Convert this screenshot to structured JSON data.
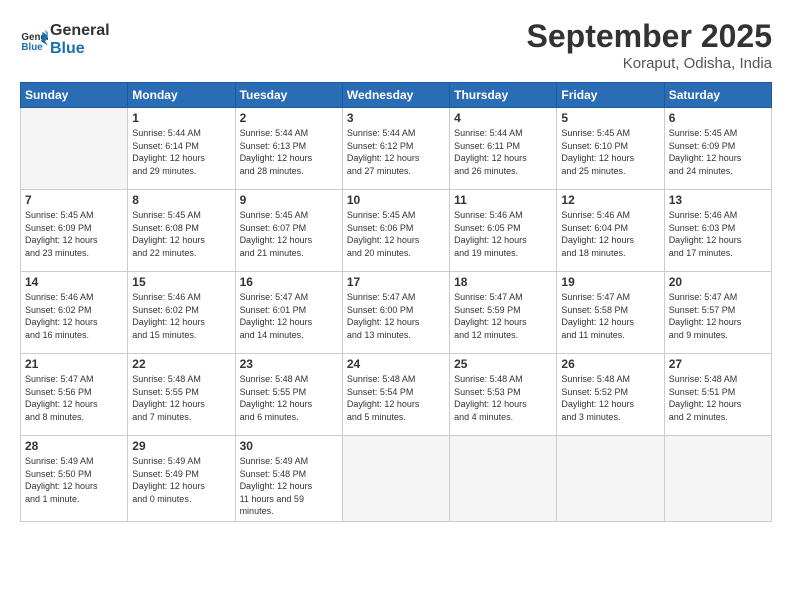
{
  "logo": {
    "text_general": "General",
    "text_blue": "Blue"
  },
  "header": {
    "month": "September 2025",
    "location": "Koraput, Odisha, India"
  },
  "weekdays": [
    "Sunday",
    "Monday",
    "Tuesday",
    "Wednesday",
    "Thursday",
    "Friday",
    "Saturday"
  ],
  "weeks": [
    [
      {
        "day": "",
        "empty": true
      },
      {
        "day": "1",
        "sunrise": "5:44 AM",
        "sunset": "6:14 PM",
        "daylight": "12 hours and 29 minutes."
      },
      {
        "day": "2",
        "sunrise": "5:44 AM",
        "sunset": "6:13 PM",
        "daylight": "12 hours and 28 minutes."
      },
      {
        "day": "3",
        "sunrise": "5:44 AM",
        "sunset": "6:12 PM",
        "daylight": "12 hours and 27 minutes."
      },
      {
        "day": "4",
        "sunrise": "5:44 AM",
        "sunset": "6:11 PM",
        "daylight": "12 hours and 26 minutes."
      },
      {
        "day": "5",
        "sunrise": "5:45 AM",
        "sunset": "6:10 PM",
        "daylight": "12 hours and 25 minutes."
      },
      {
        "day": "6",
        "sunrise": "5:45 AM",
        "sunset": "6:09 PM",
        "daylight": "12 hours and 24 minutes."
      }
    ],
    [
      {
        "day": "7",
        "sunrise": "5:45 AM",
        "sunset": "6:09 PM",
        "daylight": "12 hours and 23 minutes."
      },
      {
        "day": "8",
        "sunrise": "5:45 AM",
        "sunset": "6:08 PM",
        "daylight": "12 hours and 22 minutes."
      },
      {
        "day": "9",
        "sunrise": "5:45 AM",
        "sunset": "6:07 PM",
        "daylight": "12 hours and 21 minutes."
      },
      {
        "day": "10",
        "sunrise": "5:45 AM",
        "sunset": "6:06 PM",
        "daylight": "12 hours and 20 minutes."
      },
      {
        "day": "11",
        "sunrise": "5:46 AM",
        "sunset": "6:05 PM",
        "daylight": "12 hours and 19 minutes."
      },
      {
        "day": "12",
        "sunrise": "5:46 AM",
        "sunset": "6:04 PM",
        "daylight": "12 hours and 18 minutes."
      },
      {
        "day": "13",
        "sunrise": "5:46 AM",
        "sunset": "6:03 PM",
        "daylight": "12 hours and 17 minutes."
      }
    ],
    [
      {
        "day": "14",
        "sunrise": "5:46 AM",
        "sunset": "6:02 PM",
        "daylight": "12 hours and 16 minutes."
      },
      {
        "day": "15",
        "sunrise": "5:46 AM",
        "sunset": "6:02 PM",
        "daylight": "12 hours and 15 minutes."
      },
      {
        "day": "16",
        "sunrise": "5:47 AM",
        "sunset": "6:01 PM",
        "daylight": "12 hours and 14 minutes."
      },
      {
        "day": "17",
        "sunrise": "5:47 AM",
        "sunset": "6:00 PM",
        "daylight": "12 hours and 13 minutes."
      },
      {
        "day": "18",
        "sunrise": "5:47 AM",
        "sunset": "5:59 PM",
        "daylight": "12 hours and 12 minutes."
      },
      {
        "day": "19",
        "sunrise": "5:47 AM",
        "sunset": "5:58 PM",
        "daylight": "12 hours and 11 minutes."
      },
      {
        "day": "20",
        "sunrise": "5:47 AM",
        "sunset": "5:57 PM",
        "daylight": "12 hours and 9 minutes."
      }
    ],
    [
      {
        "day": "21",
        "sunrise": "5:47 AM",
        "sunset": "5:56 PM",
        "daylight": "12 hours and 8 minutes."
      },
      {
        "day": "22",
        "sunrise": "5:48 AM",
        "sunset": "5:55 PM",
        "daylight": "12 hours and 7 minutes."
      },
      {
        "day": "23",
        "sunrise": "5:48 AM",
        "sunset": "5:55 PM",
        "daylight": "12 hours and 6 minutes."
      },
      {
        "day": "24",
        "sunrise": "5:48 AM",
        "sunset": "5:54 PM",
        "daylight": "12 hours and 5 minutes."
      },
      {
        "day": "25",
        "sunrise": "5:48 AM",
        "sunset": "5:53 PM",
        "daylight": "12 hours and 4 minutes."
      },
      {
        "day": "26",
        "sunrise": "5:48 AM",
        "sunset": "5:52 PM",
        "daylight": "12 hours and 3 minutes."
      },
      {
        "day": "27",
        "sunrise": "5:48 AM",
        "sunset": "5:51 PM",
        "daylight": "12 hours and 2 minutes."
      }
    ],
    [
      {
        "day": "28",
        "sunrise": "5:49 AM",
        "sunset": "5:50 PM",
        "daylight": "12 hours and 1 minute."
      },
      {
        "day": "29",
        "sunrise": "5:49 AM",
        "sunset": "5:49 PM",
        "daylight": "12 hours and 0 minutes."
      },
      {
        "day": "30",
        "sunrise": "5:49 AM",
        "sunset": "5:48 PM",
        "daylight": "11 hours and 59 minutes."
      },
      {
        "day": "",
        "empty": true
      },
      {
        "day": "",
        "empty": true
      },
      {
        "day": "",
        "empty": true
      },
      {
        "day": "",
        "empty": true
      }
    ]
  ]
}
